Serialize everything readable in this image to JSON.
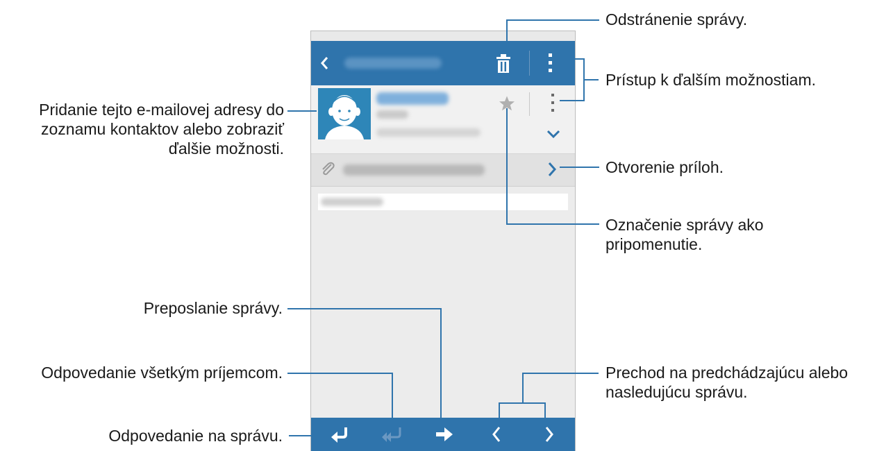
{
  "colors": {
    "accent": "#2f74ac",
    "screen_bg": "#ececec",
    "annotation_line": "#2f74ac"
  },
  "toolbar": {
    "back_icon": "chevron-left-icon",
    "delete_icon": "trash-icon",
    "more_icon": "vertical-dots-icon"
  },
  "message_header": {
    "avatar_icon": "contact-avatar-icon",
    "favorite_icon": "star-icon",
    "more_icon": "vertical-dots-icon",
    "expand_icon": "chevron-down-icon"
  },
  "attachment_row": {
    "clip_icon": "paperclip-icon",
    "open_icon": "chevron-right-icon"
  },
  "bottom_bar": {
    "reply_icon": "reply-icon",
    "reply_all_icon": "reply-all-icon",
    "forward_icon": "forward-icon",
    "prev_icon": "chevron-left-icon",
    "next_icon": "chevron-right-icon"
  },
  "annotations": {
    "delete": "Odstránenie správy.",
    "more_options": "Prístup k ďalším možnostiam.",
    "add_contact": [
      "Pridanie tejto e-mailovej adresy do",
      "zoznamu kontaktov alebo zobraziť",
      "ďalšie možnosti."
    ],
    "open_attachments": "Otvorenie príloh.",
    "mark_reminder": [
      "Označenie správy ako",
      "pripomenutie."
    ],
    "forward": "Preposlanie správy.",
    "reply_all": "Odpovedanie všetkým príjemcom.",
    "reply": "Odpovedanie na správu.",
    "prev_next": [
      "Prechod na predchádzajúcu alebo",
      "nasledujúcu správu."
    ]
  }
}
